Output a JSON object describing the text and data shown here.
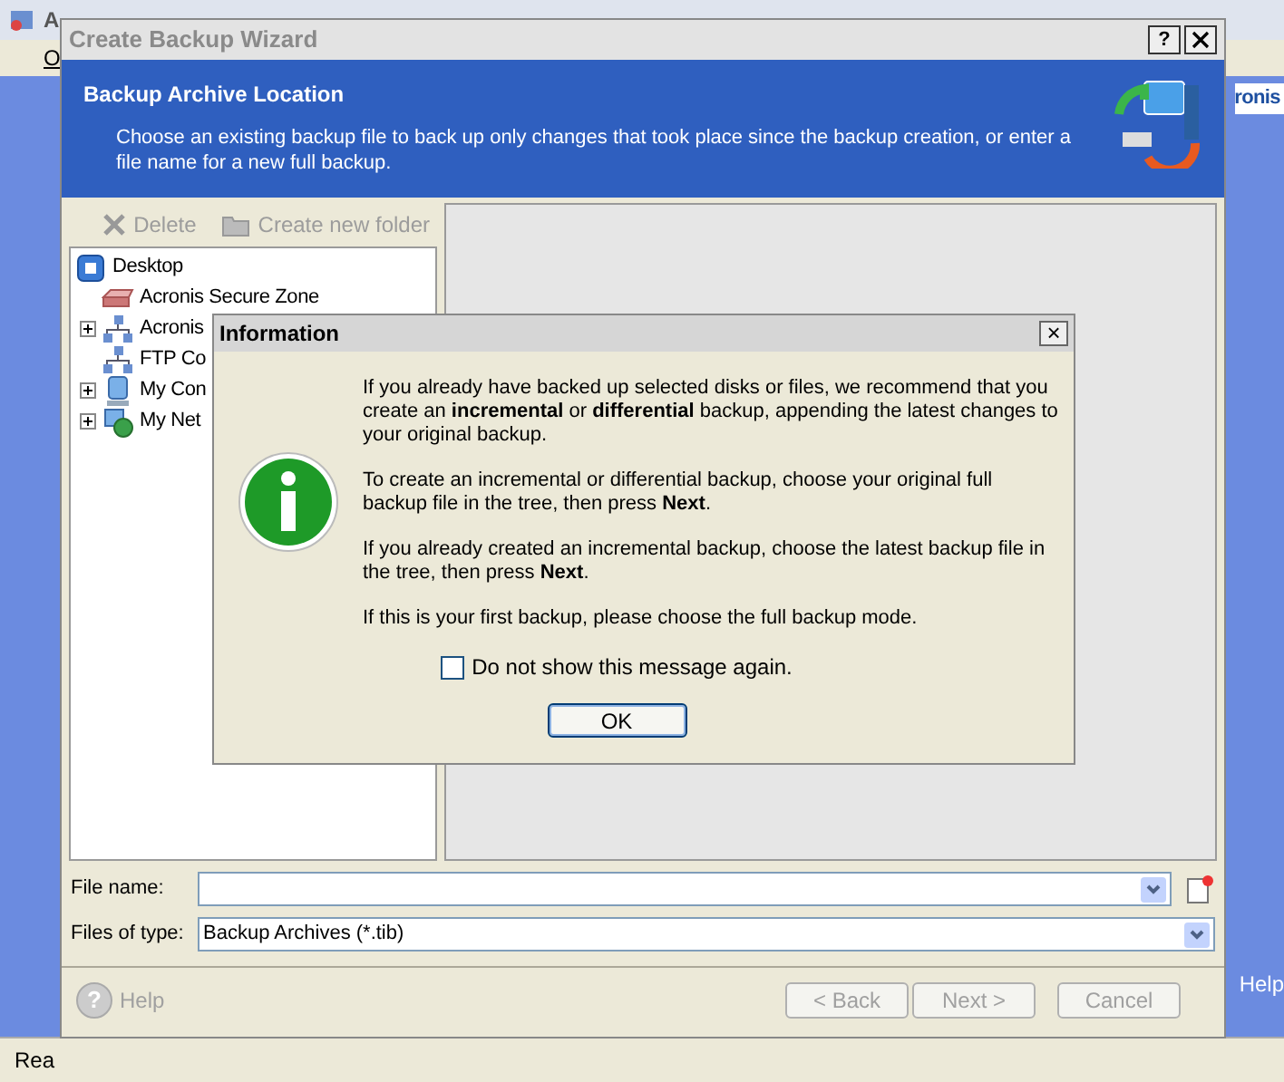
{
  "background_app": {
    "title": "A",
    "menu_item": "O",
    "brand": "ronis",
    "help_link": "Help",
    "status_bar": "Rea"
  },
  "wizard": {
    "title": "Create Backup Wizard",
    "header": {
      "title": "Backup Archive Location",
      "description": "Choose an existing backup file to back up only changes that took place since the backup creation, or enter a file name for a new full backup."
    },
    "toolbar": [
      {
        "kind": "delete",
        "label": "Delete",
        "disabled": true
      },
      {
        "kind": "folder",
        "label": "Create new folder",
        "disabled": true
      }
    ],
    "tree": [
      {
        "label": "Desktop",
        "kind": "desktop",
        "children": [
          {
            "label": "Acronis Secure Zone",
            "kind": "zone",
            "expandable": false
          },
          {
            "label": "Acronis",
            "kind": "network",
            "expandable": true
          },
          {
            "label": "FTP Co",
            "kind": "network",
            "expandable": false
          },
          {
            "label": "My Con",
            "kind": "computer",
            "expandable": true
          },
          {
            "label": "My Net",
            "kind": "globe",
            "expandable": true
          }
        ]
      }
    ],
    "title_help_glyph": "?",
    "file_name": {
      "label": "File name:"
    },
    "files_of_type": {
      "label": "Files of type:",
      "value": "Backup Archives (*.tib)"
    },
    "help": {
      "label": "Help",
      "glyph": "?",
      "disabled": true
    },
    "buttons": [
      {
        "label": "< Back",
        "disabled": true
      },
      {
        "label": "Next >",
        "disabled": true
      },
      {
        "label": "Cancel",
        "disabled": true
      }
    ]
  },
  "dialog": {
    "title": "Information",
    "close": "×",
    "paragraphs": [
      "If you already have backed up selected disks or files, we recommend that you create an **incremental** or **differential** backup, appending the latest changes to your original backup.",
      "To create an incremental or differential backup, choose your original full backup file in the tree, then press **Next**.",
      "If you already created an incremental backup, choose the latest backup file in the tree, then press **Next**.",
      "If this is your first backup, please choose the full backup mode."
    ],
    "checkbox": {
      "label": "Do not show this message again.",
      "checked": false
    },
    "ok": "OK"
  }
}
